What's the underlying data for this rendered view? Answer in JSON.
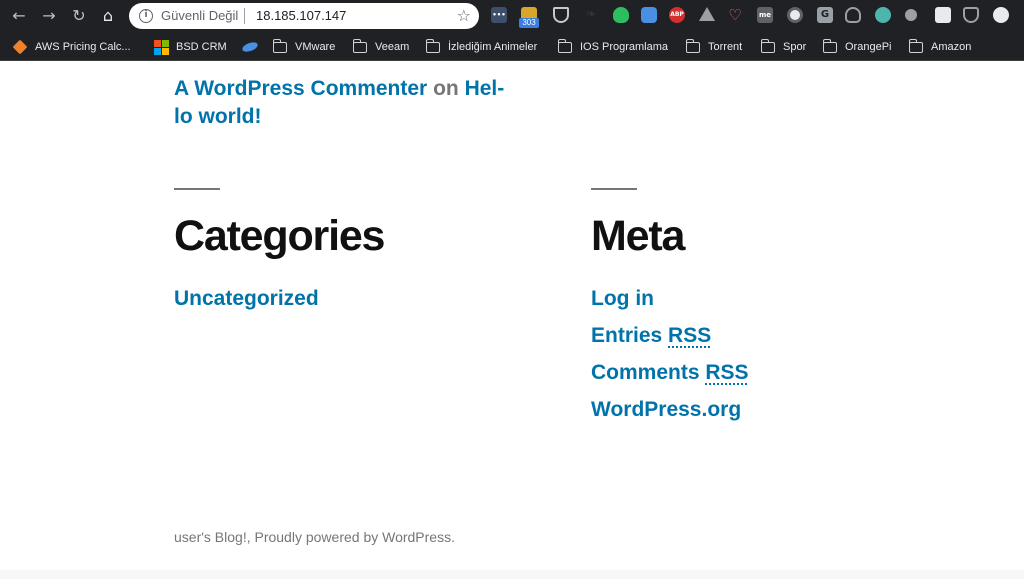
{
  "browser": {
    "back_glyph": "←",
    "forward_glyph": "→",
    "reload_glyph": "↻",
    "home_glyph": "⌂",
    "security_label": "Güvenli Değil",
    "url": "18.185.107.147",
    "extension_badge": "303",
    "ext_labels": {
      "dots": "•••",
      "abp": "ABP",
      "me": "me",
      "g": "G"
    }
  },
  "bookmarks": [
    {
      "label": "AWS Pricing Calc...",
      "icon": "aws-cube-icon"
    },
    {
      "label": "BSD CRM",
      "icon": "microsoft-logo-icon"
    },
    {
      "label": "",
      "icon": "swoosh-icon"
    },
    {
      "label": "VMware",
      "icon": "folder-icon"
    },
    {
      "label": "Veeam",
      "icon": "folder-icon"
    },
    {
      "label": "İzlediğim Animeler",
      "icon": "folder-icon"
    },
    {
      "label": "IOS Programlama",
      "icon": "folder-icon"
    },
    {
      "label": "Torrent",
      "icon": "folder-icon"
    },
    {
      "label": "Spor",
      "icon": "folder-icon"
    },
    {
      "label": "OrangePi",
      "icon": "folder-icon"
    },
    {
      "label": "Amazon",
      "icon": "folder-icon"
    }
  ],
  "recent_comment": {
    "author": "A WordPress Commenter",
    "connector": "on",
    "post_line1": "Hel-",
    "post_line2": "lo world!"
  },
  "categories": {
    "title": "Categories",
    "items": [
      "Uncategorized"
    ]
  },
  "meta": {
    "title": "Meta",
    "login": "Log in",
    "entries_prefix": "Entries",
    "comments_prefix": "Comments",
    "rss": "RSS",
    "wordpress_org": "WordPress.org"
  },
  "footer": {
    "text": "user's Blog!, Proudly powered by WordPress."
  },
  "colors": {
    "link": "#0073aa",
    "heading": "#111111",
    "muted": "#767676",
    "chrome": "#202124"
  }
}
